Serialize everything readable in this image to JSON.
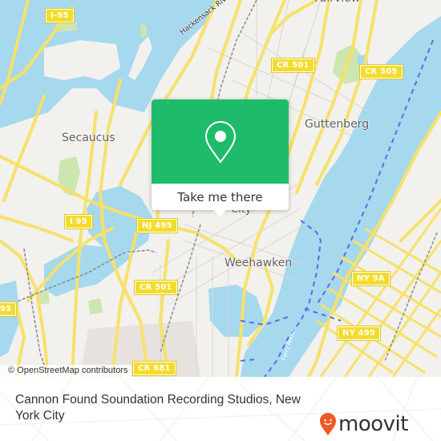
{
  "map": {
    "place_labels": [
      {
        "id": "fairview",
        "text": "Fairview"
      },
      {
        "id": "secaucus",
        "text": "Secaucus"
      },
      {
        "id": "guttenberg",
        "text": "Guttenberg"
      },
      {
        "id": "weehawken",
        "text": "Weehawken"
      },
      {
        "id": "union-city",
        "text": "City"
      }
    ],
    "river_labels": [
      {
        "id": "hackensack",
        "text": "Hackensack River"
      },
      {
        "id": "ferry",
        "text": "Ferry Route"
      }
    ],
    "road_shields": [
      {
        "id": "i95-top",
        "text": "I-95"
      },
      {
        "id": "cr501-top",
        "text": "CR 501"
      },
      {
        "id": "cr505",
        "text": "CR 505"
      },
      {
        "id": "i95-mid",
        "text": "I 95"
      },
      {
        "id": "nj495",
        "text": "NJ 495"
      },
      {
        "id": "cr501-mid",
        "text": "CR 501"
      },
      {
        "id": "ny9a",
        "text": "NY 9A"
      },
      {
        "id": "ny495",
        "text": "NY 495"
      },
      {
        "id": "i95-left",
        "text": "95"
      },
      {
        "id": "cr681",
        "text": "CR 681"
      }
    ],
    "attribution": "© OpenStreetMap contributors",
    "colors": {
      "water": "#a6d8ee",
      "land": "#f2f1ed",
      "park": "#cde6b0",
      "road": "#f7e16a",
      "ferry": "#5b6be8"
    }
  },
  "popup": {
    "icon": "map-pin-icon",
    "button_label": "Take me there",
    "accent_color": "#1ebc6a"
  },
  "footer": {
    "title": "Cannon Found Soundation Recording Studios, New York City",
    "logo_text": "moovit",
    "logo_color": "#f05a28"
  }
}
